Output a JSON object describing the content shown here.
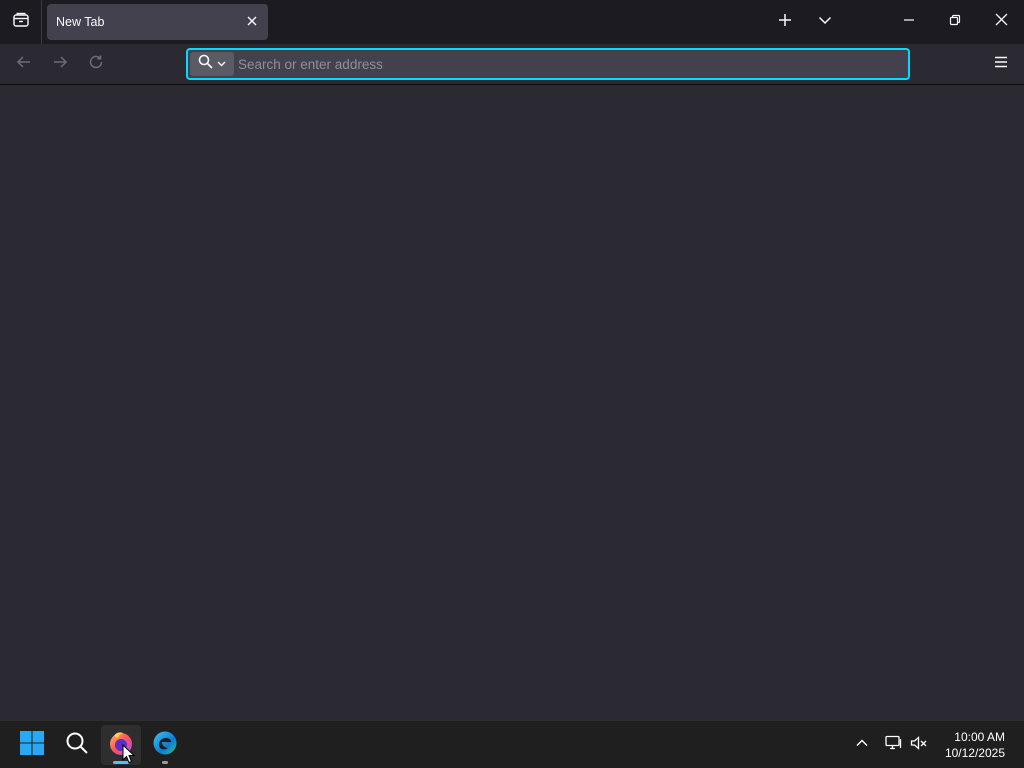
{
  "browser": {
    "tab": {
      "title": "New Tab"
    },
    "urlbar": {
      "placeholder": "Search or enter address",
      "value": ""
    }
  },
  "icons": {
    "tab_overview": "tab-overview-icon",
    "tab_close": "close-icon",
    "new_tab": "plus-icon",
    "list_tabs": "chevron-down-icon",
    "minimize": "minimize-icon",
    "restore": "restore-icon",
    "close_window": "close-icon",
    "back": "back-arrow-icon",
    "forward": "forward-arrow-icon",
    "reload": "reload-icon",
    "search_engine": "search-icon",
    "menu": "hamburger-menu-icon"
  },
  "taskbar": {
    "apps": [
      "start",
      "search",
      "firefox",
      "edge"
    ],
    "clock": {
      "time": "10:00 AM",
      "date": "10/12/2025"
    }
  },
  "colors": {
    "accent_focus": "#00ddff",
    "tabbar_bg": "#1c1b22",
    "content_bg": "#2b2a33",
    "active_tab_bg": "#42414d",
    "taskbar_bg": "#1f1f1f",
    "windows_blue": "#2aa8f2"
  }
}
